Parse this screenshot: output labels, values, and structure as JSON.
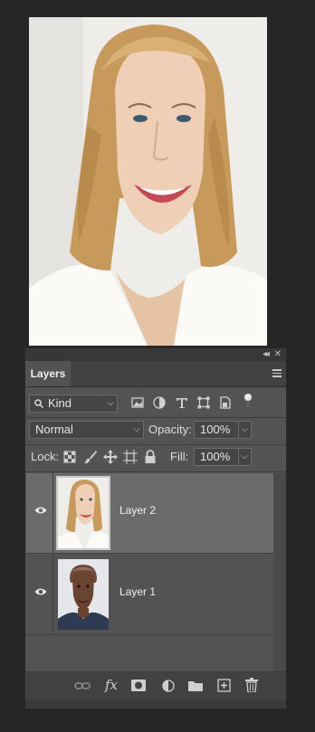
{
  "panel": {
    "tab_label": "Layers",
    "filter": {
      "label": "Kind"
    },
    "blend_mode": "Normal",
    "opacity_label": "Opacity:",
    "opacity_value": "100%",
    "lock_label": "Lock:",
    "fill_label": "Fill:",
    "fill_value": "100%",
    "layers": [
      {
        "name": "Layer 2",
        "visible": true,
        "selected": true
      },
      {
        "name": "Layer 1",
        "visible": true,
        "selected": false
      }
    ]
  },
  "colors": {
    "panel_bg": "#535353",
    "selected_layer": "#6b6b6b",
    "app_bg": "#262626"
  }
}
